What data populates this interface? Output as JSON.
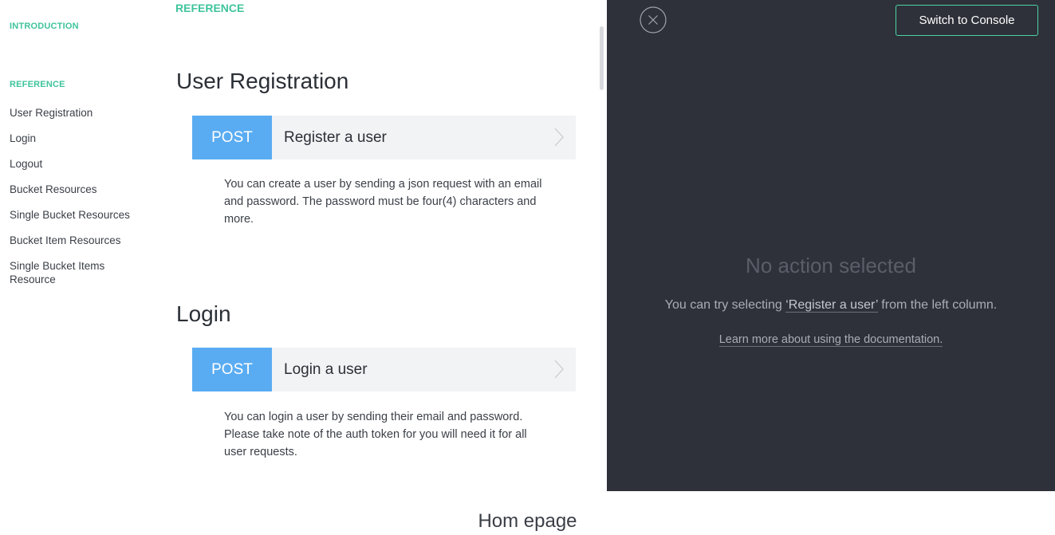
{
  "sidebar": {
    "intro_label": "INTRODUCTION",
    "reference_label": "REFERENCE",
    "items": [
      {
        "label": "User Registration"
      },
      {
        "label": "Login"
      },
      {
        "label": "Logout"
      },
      {
        "label": "Bucket Resources"
      },
      {
        "label": "Single Bucket Resources"
      },
      {
        "label": "Bucket Item Resources"
      },
      {
        "label": "Single Bucket Items Resource"
      }
    ]
  },
  "main": {
    "section_label": "REFERENCE",
    "sections": [
      {
        "title": "User Registration",
        "endpoint": {
          "method": "POST",
          "name": "Register a user"
        },
        "description": "You can create a user by sending a json request with an email and password. The password must be four(4) characters and more."
      },
      {
        "title": "Login",
        "endpoint": {
          "method": "POST",
          "name": "Login a user"
        },
        "description": "You can login a user by sending their email and password. Please take note of the auth token for you will need it for all user requests."
      }
    ]
  },
  "console": {
    "switch_label": "Switch to Console",
    "empty_title": "No action selected",
    "empty_prefix": "You can try selecting ",
    "empty_link": "‘Register a user’",
    "empty_suffix": " from the left column.",
    "learn_more": "Learn more about using the documentation."
  },
  "caption": "Hom epage",
  "colors": {
    "accent": "#3fc49b",
    "method_bg": "#5aacf2",
    "console_bg": "#2e3139",
    "button_border": "#4bd3a7"
  },
  "icons": {
    "close": "close-circle-icon",
    "chevron": "chevron-right-icon"
  }
}
